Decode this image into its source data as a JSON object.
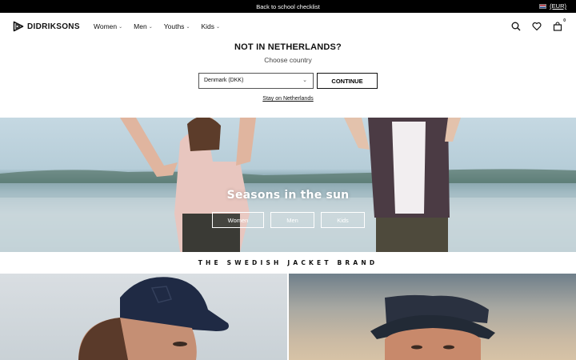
{
  "topbar": {
    "message": "Back to school checklist",
    "currency": "(EUR)"
  },
  "nav": {
    "logo": "DIDRIKSONS",
    "menu": [
      {
        "label": "Women"
      },
      {
        "label": "Men"
      },
      {
        "label": "Youths"
      },
      {
        "label": "Kids"
      }
    ],
    "cart_count": "0"
  },
  "country_selector": {
    "title": "NOT IN NETHERLANDS?",
    "subtitle": "Choose country",
    "selected": "Denmark (DKK)",
    "continue_label": "CONTINUE",
    "stay_label": "Stay on Netherlands"
  },
  "hero": {
    "title": "Seasons in the sun",
    "buttons": [
      {
        "label": "Women"
      },
      {
        "label": "Men"
      },
      {
        "label": "Kids"
      }
    ]
  },
  "brand_strip": {
    "text": "THE SWEDISH JACKET BRAND"
  },
  "colors": {
    "topbar_bg": "#000000",
    "text": "#111111",
    "hero_text": "#ffffff"
  },
  "icons": [
    "didriksons-logo-icon",
    "chevron-down-icon",
    "search-icon",
    "heart-icon",
    "bag-icon",
    "netherlands-flag-icon"
  ]
}
